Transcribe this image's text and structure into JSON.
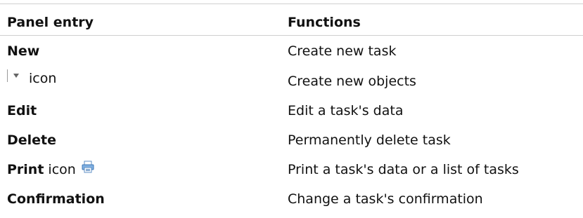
{
  "table": {
    "header": {
      "entry": "Panel entry",
      "functions": "Functions"
    },
    "rows": [
      {
        "entry": "New",
        "functions": "Create new task"
      },
      {
        "icon": "dropdown-arrow-icon",
        "entry_suffix": "icon",
        "functions": "Create new objects"
      },
      {
        "entry": "Edit",
        "functions": "Edit a task's data"
      },
      {
        "entry": "Delete",
        "functions": "Permanently delete task"
      },
      {
        "entry": "Print",
        "entry_suffix": "icon",
        "icon": "printer-icon",
        "functions": "Print a task's data or a list of tasks"
      },
      {
        "entry": "Confirmation",
        "functions": "Change a task's confirmation"
      }
    ]
  }
}
